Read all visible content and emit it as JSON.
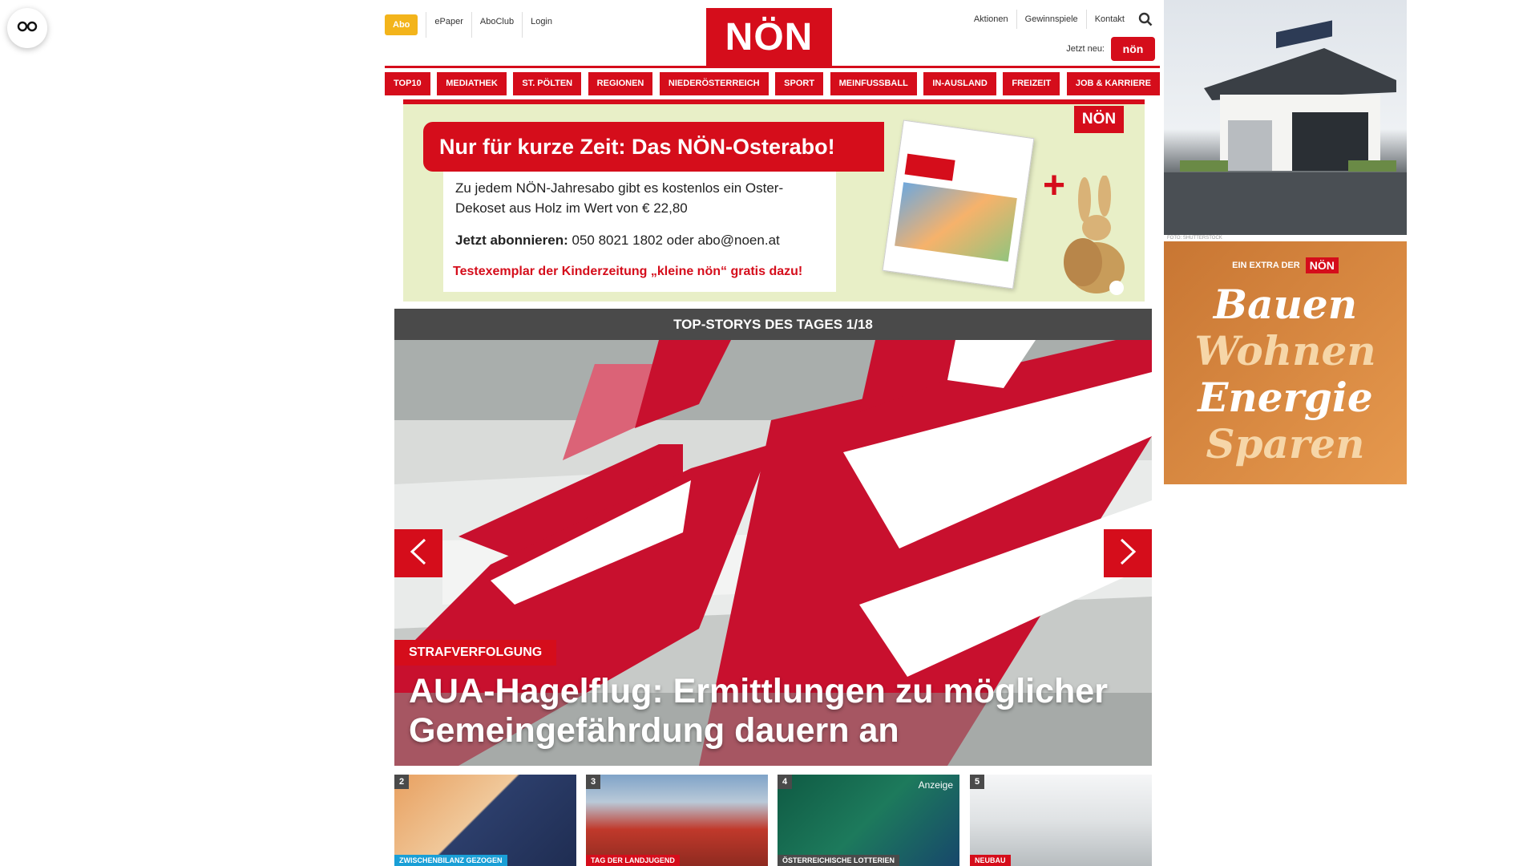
{
  "accessibility": {
    "icon": "glasses-icon"
  },
  "header": {
    "abo_label": "Abo",
    "links": [
      "ePaper",
      "AboClub",
      "Login"
    ],
    "logo": "NÖN",
    "right_links": [
      "Aktionen",
      "Gewinnspiele",
      "Kontakt"
    ],
    "search_icon": "search-icon",
    "jetzt_label": "Jetzt neu:",
    "kleine_logo": "nön"
  },
  "nav": {
    "items": [
      "TOP10",
      "MEDIATHEK",
      "ST. PÖLTEN",
      "REGIONEN",
      "NIEDERÖSTERREICH",
      "SPORT",
      "MEINFUSSBALL",
      "IN-AUSLAND",
      "FREIZEIT",
      "JOB & KARRIERE"
    ]
  },
  "promo": {
    "headline": "Nur für kurze Zeit: Das NÖN-Osterabo!",
    "text": "Zu jedem NÖN-Jahresabo gibt es kostenlos ein Oster-Dekoset aus Holz im Wert von € 22,80",
    "contact_bold": "Jetzt abonnieren:",
    "contact": "050 8021 1802 oder abo@noen.at",
    "red_text": "Testexemplar der Kinderzeitung „kleine nön“ gratis dazu!",
    "logo": "NÖN",
    "plus": "+"
  },
  "stories": {
    "bar_title": "TOP-STORYS DES TAGES 1/18",
    "hero_tag": "STRAFVERFOLGUNG",
    "hero_title": "AUA-Hagelflug: Ermittlungen zu möglicher Gemeingefährdung dauern an",
    "thumbs": [
      {
        "num": "2",
        "label": "ZWISCHENBILANZ GEZOGEN",
        "label_color": "#1a9fd6",
        "anzeige": ""
      },
      {
        "num": "3",
        "label": "TAG DER LANDJUGEND",
        "label_color": "#d50d1b",
        "anzeige": ""
      },
      {
        "num": "4",
        "label": "ÖSTERREICHISCHE LOTTERIEN",
        "label_color": "#4a4a4a",
        "anzeige": "Anzeige"
      },
      {
        "num": "5",
        "label": "NEUBAU",
        "label_color": "#d50d1b",
        "anzeige": ""
      }
    ]
  },
  "ads": {
    "house_caption": "FOTO: SHUTTERSTOCK",
    "extra_label": "EIN EXTRA DER",
    "extra_logo": "NÖN",
    "words": [
      "Bauen",
      "Wohnen",
      "Energie",
      "Sparen"
    ]
  },
  "colors": {
    "brand_red": "#d50d1b",
    "abo_yellow": "#f3b41b",
    "bar_gray": "#4a4a4a"
  }
}
